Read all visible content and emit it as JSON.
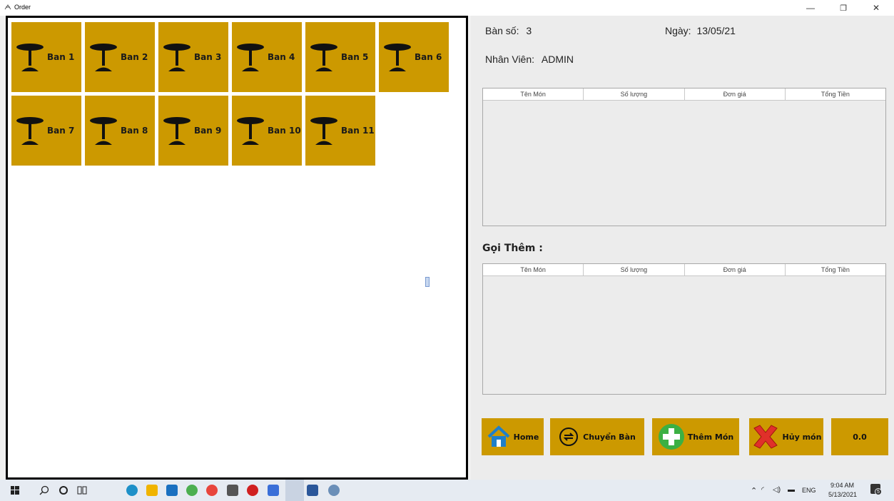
{
  "window": {
    "title": "Order",
    "minimize": "—",
    "restore": "❐",
    "close": "✕"
  },
  "tables": [
    {
      "label": "Ban 1"
    },
    {
      "label": "Ban 2"
    },
    {
      "label": "Ban 3"
    },
    {
      "label": "Ban 4"
    },
    {
      "label": "Ban 5"
    },
    {
      "label": "Ban 6"
    },
    {
      "label": "Ban 7"
    },
    {
      "label": "Ban 8"
    },
    {
      "label": "Ban 9"
    },
    {
      "label": "Ban 10"
    },
    {
      "label": "Ban 11"
    }
  ],
  "info": {
    "table_label": "Bàn số:",
    "table_value": "3",
    "date_label": "Ngày:",
    "date_value": "13/05/21",
    "staff_label": "Nhân Viên:",
    "staff_value": "ADMIN"
  },
  "order_grid": {
    "columns": [
      "Tên Món",
      "Số lượng",
      "Đơn giá",
      "Tổng Tiền"
    ],
    "rows": []
  },
  "extra": {
    "title": "Gọi Thêm :"
  },
  "extra_grid": {
    "columns": [
      "Tên Món",
      "Số lượng",
      "Đơn giá",
      "Tổng Tiền"
    ],
    "rows": []
  },
  "actions": {
    "home": "Home",
    "move": "Chuyển Bàn",
    "add": "Thêm Món",
    "cancel": "Hủy món",
    "total": "0.0"
  },
  "taskbar": {
    "lang": "ENG",
    "time": "9:04 AM",
    "date": "5/13/2021",
    "notifications": "5"
  },
  "colors": {
    "table_button": "#cc9900",
    "panel": "#ececec"
  }
}
